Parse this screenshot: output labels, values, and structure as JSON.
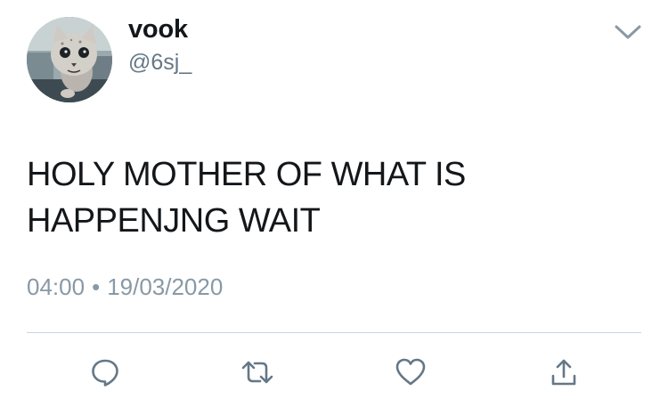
{
  "user": {
    "display_name": "vook",
    "handle": "@6sj_"
  },
  "tweet": {
    "text_lines": [
      "HOLY MOTHER OF WHAT IS",
      "HAPPENJNG WAIT"
    ],
    "time": "04:00",
    "separator": "•",
    "date": "19/03/2020"
  },
  "icons": {
    "menu": "chevron-down-icon",
    "reply": "reply-icon",
    "retweet": "retweet-icon",
    "like": "heart-icon",
    "share": "share-icon"
  },
  "colors": {
    "text": "#14171a",
    "secondary_text": "#657786",
    "meta_text": "#8899a6",
    "icon": "#657786",
    "divider": "#ccd6dd"
  }
}
